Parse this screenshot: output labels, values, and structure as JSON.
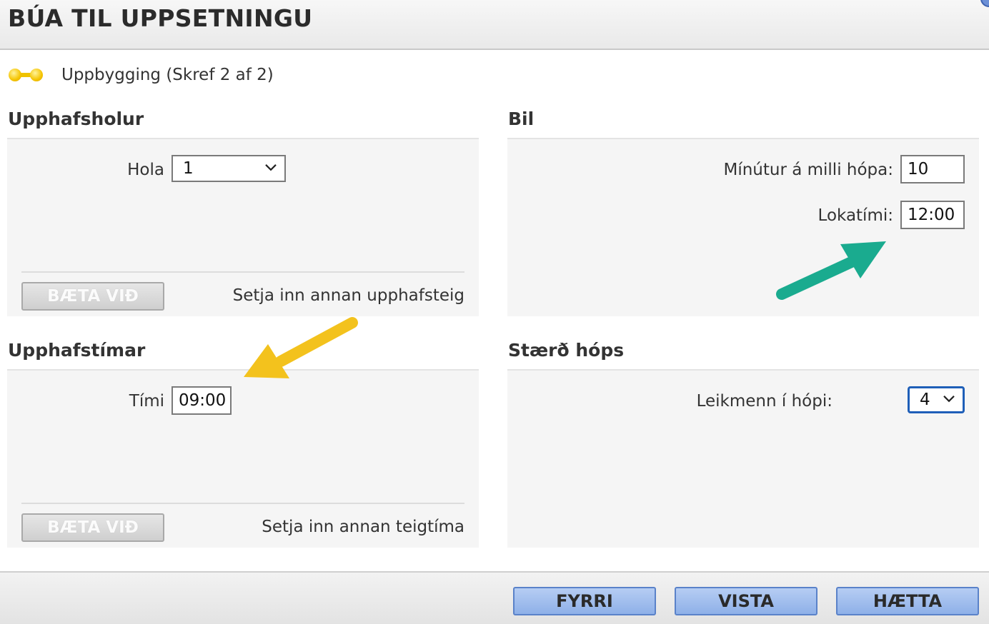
{
  "header": {
    "title": "BÚA TIL UPPSETNINGU"
  },
  "step": {
    "label": "Uppbygging (Skref 2 af 2)"
  },
  "start_holes": {
    "title": "Upphafsholur",
    "hole_label": "Hola",
    "hole_value": "1",
    "add_button": "BÆTA VIÐ",
    "add_hint": "Setja inn annan upphafsteig"
  },
  "interval": {
    "title": "Bil",
    "minutes_label": "Mínútur á milli hópa:",
    "minutes_value": "10",
    "end_time_label": "Lokatími:",
    "end_time_value": "12:00"
  },
  "start_times": {
    "title": "Upphafstímar",
    "time_label": "Tími",
    "time_value": "09:00",
    "add_button": "BÆTA VIÐ",
    "add_hint": "Setja inn annan teigtíma"
  },
  "group_size": {
    "title": "Stærð hóps",
    "players_label": "Leikmenn í hópi:",
    "players_value": "4"
  },
  "footer": {
    "prev_button": "FYRRI",
    "save_button": "VISTA",
    "cancel_button": "HÆTTA"
  },
  "colors": {
    "primary_button": "#9ab9ec",
    "focus_border": "#1f5fb8",
    "annotation_teal": "#1aab8f",
    "annotation_yellow": "#f3c21d"
  },
  "icons": [
    "step-progress-icon",
    "chevron-down-icon",
    "arrow-annotation-icon"
  ]
}
